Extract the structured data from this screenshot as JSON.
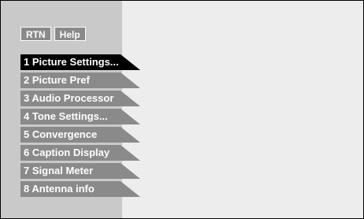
{
  "top_buttons": {
    "rtn_label": "RTN",
    "help_label": "Help"
  },
  "menu": {
    "selected_index": 0,
    "items": [
      {
        "label": "1 Picture Settings..."
      },
      {
        "label": "2 Picture Pref"
      },
      {
        "label": "3 Audio Processor"
      },
      {
        "label": "4 Tone Settings..."
      },
      {
        "label": "5 Convergence"
      },
      {
        "label": "6 Caption Display"
      },
      {
        "label": "7 Signal Meter"
      },
      {
        "label": "8 Antenna info"
      }
    ]
  },
  "colors": {
    "panel_background": "#ededed",
    "sidebar_background": "#c9c9c9",
    "item_background": "#8a8a8a",
    "item_selected_background": "#000000",
    "text": "#ffffff"
  }
}
